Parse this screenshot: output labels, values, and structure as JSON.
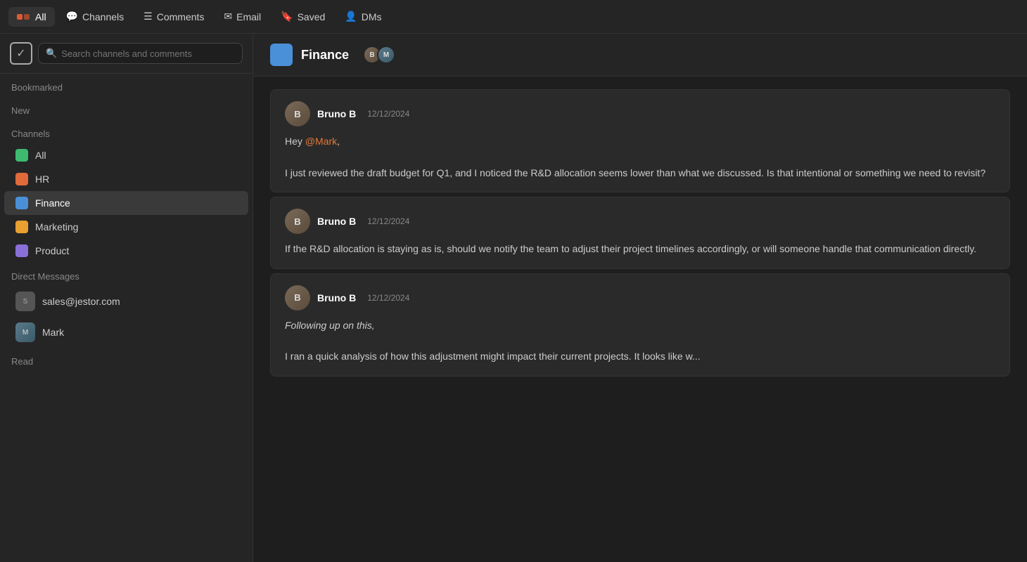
{
  "nav": {
    "items": [
      {
        "id": "all",
        "label": "All",
        "icon": "⊞",
        "active": true
      },
      {
        "id": "channels",
        "label": "Channels",
        "icon": "💬"
      },
      {
        "id": "comments",
        "label": "Comments",
        "icon": "☰"
      },
      {
        "id": "email",
        "label": "Email",
        "icon": "✉"
      },
      {
        "id": "saved",
        "label": "Saved",
        "icon": "🔖"
      },
      {
        "id": "dms",
        "label": "DMs",
        "icon": "👤"
      }
    ]
  },
  "sidebar": {
    "search_placeholder": "Search channels and comments",
    "sections": [
      {
        "label": "Bookmarked",
        "items": []
      },
      {
        "label": "New",
        "items": []
      },
      {
        "label": "Channels",
        "items": [
          {
            "id": "all",
            "label": "All",
            "color": "#3dba6f",
            "active": false
          },
          {
            "id": "hr",
            "label": "HR",
            "color": "#e06a3a",
            "active": false
          },
          {
            "id": "finance",
            "label": "Finance",
            "color": "#4a90d9",
            "active": true
          },
          {
            "id": "marketing",
            "label": "Marketing",
            "color": "#e8a030",
            "active": false
          },
          {
            "id": "product",
            "label": "Product",
            "color": "#8a6fd9",
            "active": false
          }
        ]
      },
      {
        "label": "Direct Messages",
        "items": [
          {
            "id": "sales",
            "label": "sales@jestor.com",
            "initials": "S"
          },
          {
            "id": "mark",
            "label": "Mark",
            "initials": "M"
          }
        ]
      },
      {
        "label": "Read",
        "items": []
      }
    ]
  },
  "channel": {
    "name": "Finance",
    "color": "#4a90d9",
    "avatars": [
      "B",
      "M"
    ]
  },
  "messages": [
    {
      "id": 1,
      "sender": "Bruno B",
      "date": "12/12/2024",
      "body_parts": [
        {
          "type": "text",
          "text": "Hey "
        },
        {
          "type": "mention",
          "text": "@Mark"
        },
        {
          "type": "text",
          "text": ","
        }
      ],
      "body2": "I just reviewed the draft budget for Q1, and I noticed the R&D allocation seems lower than what we discussed. Is that intentional or something we need to revisit?",
      "italic": false
    },
    {
      "id": 2,
      "sender": "Bruno B",
      "date": "12/12/2024",
      "body_plain": "If the R&D allocation is staying as is, should we notify the team to adjust their project timelines accordingly, or will someone handle that communication directly.",
      "italic": false
    },
    {
      "id": 3,
      "sender": "Bruno B",
      "date": "12/12/2024",
      "body_italic": "Following up on this,",
      "body2": "I ran a quick analysis of how this adjustment might impact their current projects. It looks like w...",
      "italic": true
    }
  ],
  "labels": {
    "bookmarked": "Bookmarked",
    "new": "New",
    "channels": "Channels",
    "direct_messages": "Direct Messages",
    "read": "Read"
  }
}
